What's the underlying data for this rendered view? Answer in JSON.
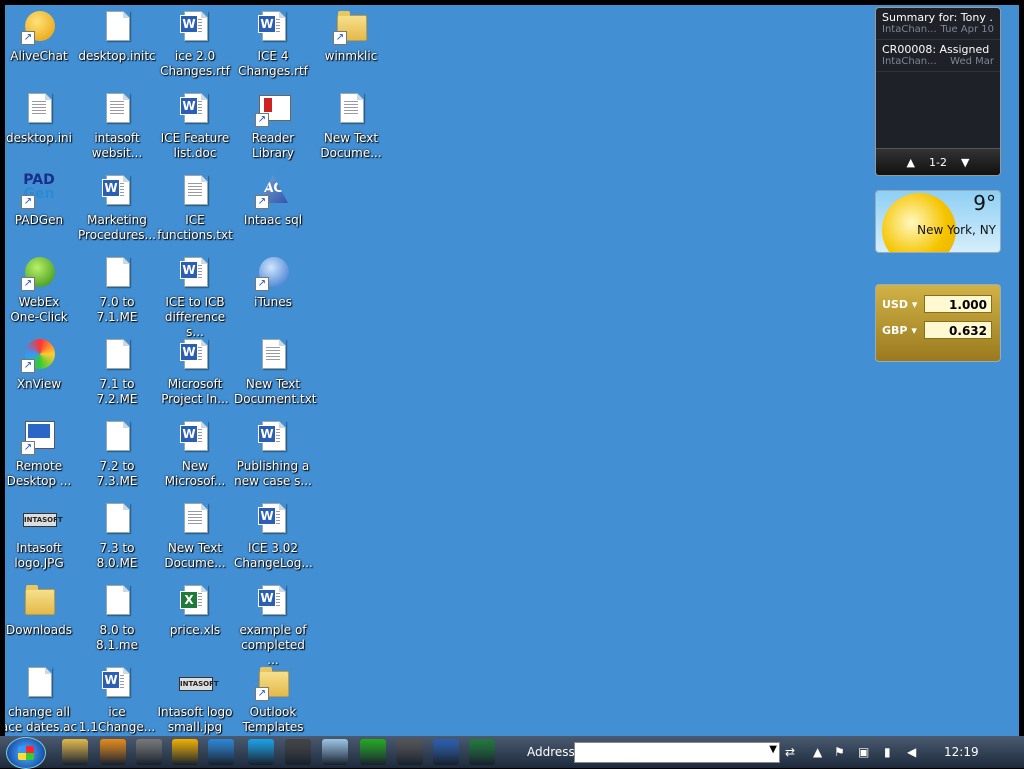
{
  "desktop": {
    "icons": [
      {
        "label": "AliveChat",
        "icon": "alivechat-icon"
      },
      {
        "label": "desktop.initc",
        "icon": "file-icon"
      },
      {
        "label": "ice 2.0\nChanges.rtf",
        "icon": "word-doc-icon"
      },
      {
        "label": "ICE 4\nChanges.rtf",
        "icon": "word-doc-icon"
      },
      {
        "label": "winmklic",
        "icon": "folder-shortcut-icon"
      },
      {
        "label": "desktop.ini",
        "icon": "settings-file-icon"
      },
      {
        "label": "intasoft\nwebsit...",
        "icon": "text-file-icon"
      },
      {
        "label": "ICE Feature\nlist.doc",
        "icon": "word-doc-icon"
      },
      {
        "label": "Reader\nLibrary",
        "icon": "reader-library-icon"
      },
      {
        "label": "New Text\nDocume...",
        "icon": "text-file-icon"
      },
      {
        "label": "PADGen",
        "icon": "padgen-icon"
      },
      {
        "label": "Marketing\nProcedures...",
        "icon": "word-doc-icon"
      },
      {
        "label": "ICE\nfunctions.txt",
        "icon": "text-file-icon"
      },
      {
        "label": "Intaac sql",
        "icon": "intaac-sql-icon"
      },
      {
        "label": "WebEx\nOne-Click",
        "icon": "webex-icon"
      },
      {
        "label": "7.0 to 7.1.ME",
        "icon": "file-icon"
      },
      {
        "label": "ICE to ICB\ndifference s...",
        "icon": "word-doc-icon"
      },
      {
        "label": "iTunes",
        "icon": "itunes-icon"
      },
      {
        "label": "XnView",
        "icon": "xnview-icon"
      },
      {
        "label": "7.1 to 7.2.ME",
        "icon": "file-icon"
      },
      {
        "label": "Microsoft\nProject In...",
        "icon": "word-doc-icon"
      },
      {
        "label": "New Text\nDocument.txt",
        "icon": "text-file-icon"
      },
      {
        "label": "Remote\nDesktop ...",
        "icon": "remote-desktop-icon"
      },
      {
        "label": "7.2 to 7.3.ME",
        "icon": "file-icon"
      },
      {
        "label": "New\nMicrosof...",
        "icon": "word-doc-icon"
      },
      {
        "label": "Publishing a\nnew case s...",
        "icon": "word-doc-icon"
      },
      {
        "label": "Intasoft\nlogo.JPG",
        "icon": "image-icon"
      },
      {
        "label": "7.3 to 8.0.ME",
        "icon": "file-icon"
      },
      {
        "label": "New Text\nDocume...",
        "icon": "text-file-icon"
      },
      {
        "label": "ICE 3.02\nChangeLog...",
        "icon": "word-doc-icon"
      },
      {
        "label": "Downloads",
        "icon": "folder-icon"
      },
      {
        "label": "8.0 to 8.1.me",
        "icon": "file-icon"
      },
      {
        "label": "price.xls",
        "icon": "excel-icon"
      },
      {
        "label": "example of\ncompleted ...",
        "icon": "word-doc-icon"
      },
      {
        "label": "change all\nace dates.ac",
        "icon": "file-icon"
      },
      {
        "label": "ice\n1.1Change...",
        "icon": "word-doc-icon"
      },
      {
        "label": "Intasoft logo\nsmall.jpg",
        "icon": "image-icon"
      },
      {
        "label": "Outlook\nTemplates",
        "icon": "folder-shortcut-icon"
      }
    ]
  },
  "gadgets": {
    "feed": {
      "items": [
        {
          "title": "Summary for: Tony ...",
          "source": "IntaChan...",
          "date": "Tue Apr 10"
        },
        {
          "title": "CR00008: Assigned",
          "source": "IntaChan...",
          "date": "Wed Mar"
        }
      ],
      "pager": "1-2"
    },
    "weather": {
      "temp": "9°",
      "city": "New York, NY"
    },
    "currency": {
      "rows": [
        {
          "code": "USD",
          "value": "1.000"
        },
        {
          "code": "GBP",
          "value": "0.632"
        }
      ]
    }
  },
  "taskbar": {
    "address_label": "Address",
    "address_value": "",
    "clock": "12:19",
    "apps": [
      "explorer-icon",
      "media-player-icon",
      "app-icon",
      "outlook-icon",
      "ie-icon",
      "skype-icon",
      "xnview-icon",
      "notepad-icon",
      "green-app-icon",
      "gimp-icon",
      "word-icon",
      "excel-icon"
    ]
  }
}
